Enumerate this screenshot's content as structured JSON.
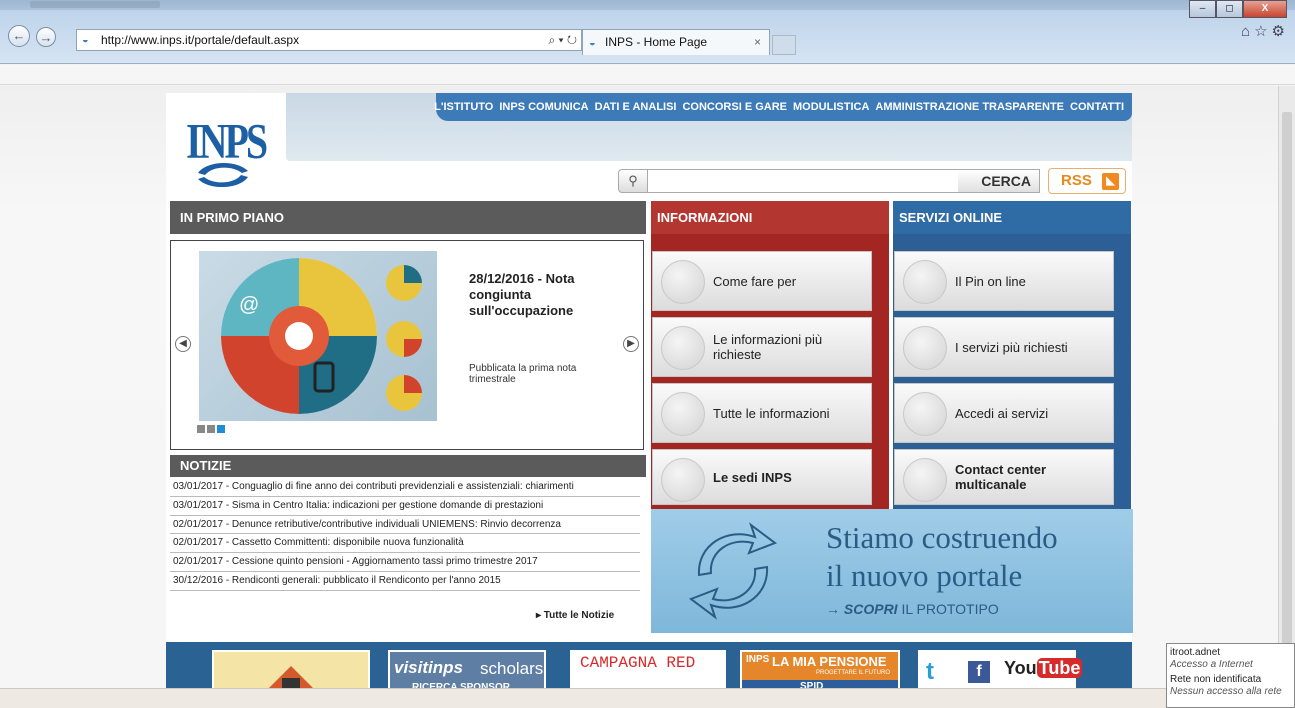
{
  "browser": {
    "url": "http://www.inps.it/portale/default.aspx",
    "tab_title": "INPS - Home Page",
    "tab_close": "×",
    "addr_tools": "⌕ ▾ ↻",
    "right_tools": "⌂☆⚙",
    "win_min": "–",
    "win_max": "◻",
    "win_close": "X",
    "back_glyph": "←",
    "forward_glyph": "→"
  },
  "site": {
    "logo_text": "INPS",
    "top_nav": [
      "L'ISTITUTO",
      "INPS COMUNICA",
      "DATI E ANALISI",
      "CONCORSI E GARE",
      "MODULISTICA",
      "AMMINISTRAZIONE TRASPARENTE",
      "CONTATTI"
    ],
    "search_button": "CERCA",
    "rss_label": "RSS",
    "primo_piano": {
      "heading": "IN PRIMO PIANO",
      "slide_title": "28/12/2016 - Nota congiunta sull'occupazione",
      "slide_subtitle": "Pubblicata la prima nota trimestrale",
      "dots_active": 3,
      "dots_total": 3
    },
    "notizie": {
      "heading": "NOTIZIE",
      "items": [
        "03/01/2017 - Conguaglio di fine anno dei contributi previdenziali e assistenziali: chiarimenti",
        "03/01/2017 - Sisma in Centro Italia: indicazioni per gestione domande di prestazioni",
        "02/01/2017 - Denunce retributive/contributive individuali UNIEMENS: Rinvio decorrenza",
        "02/01/2017 - Cassetto Committenti: disponibile nuova funzionalità",
        "02/01/2017 - Cessione quinto pensioni - Aggiornamento tassi primo trimestre 2017",
        "30/12/2016 - Rendiconti generali: pubblicato il Rendiconto per l'anno 2015"
      ],
      "all_link": "▸ Tutte le Notizie"
    },
    "informazioni": {
      "heading": "INFORMAZIONI",
      "tiles": [
        "Come fare per",
        "Le informazioni più richieste",
        "Tutte le informazioni"
      ],
      "sedi": "Le sedi INPS"
    },
    "servizi": {
      "heading": "SERVIZI ONLINE",
      "tiles": [
        "Il Pin on line",
        "I servizi più richiesti",
        "Accedi ai servizi"
      ],
      "contact": "Contact center multicanale"
    },
    "banner": {
      "line1": "Stiamo costruendo",
      "line2": "il nuovo portale",
      "cta_arrow": "→",
      "cta_bold": "SCOPRI",
      "cta_rest": " IL PROTOTIPO"
    },
    "footer_banners": {
      "visitinps": "visitinps",
      "scholars": "scholars",
      "ricerca": "RICERCA SPONSOR",
      "campagna": "CAMPAGNA RED",
      "inps_small": "INPS",
      "pensione": "LA MIA PENSIONE",
      "progettare": "PROGETTARE IL FUTURO",
      "spid": "SPID",
      "twitter": "t",
      "facebook": "f",
      "youtube_you": "You",
      "youtube_tube": "Tube"
    }
  },
  "network_tooltip": {
    "line1": "itroot.adnet",
    "line2": "Accesso a Internet",
    "line3": "Rete non identificata",
    "line4": "Nessun accesso alla rete"
  }
}
